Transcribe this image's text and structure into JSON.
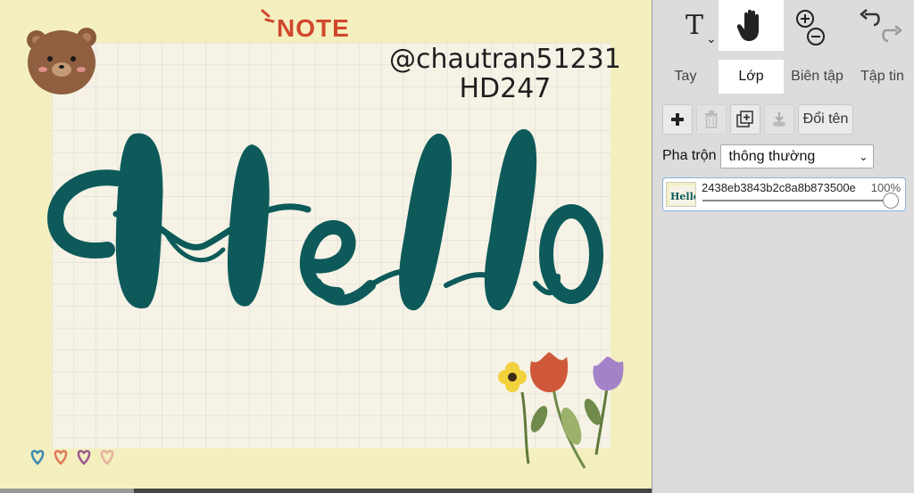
{
  "canvas": {
    "note_label": "NOTE",
    "credit_line1": "@chautran51231",
    "credit_line2": "HD247",
    "lettering": "Hello"
  },
  "toolbar": {
    "text_tool": "T",
    "hand_tool_icon": "hand-icon",
    "zoom_icons": [
      "zoom-in-icon",
      "zoom-out-icon"
    ],
    "history_icons": [
      "undo-icon",
      "redo-icon"
    ]
  },
  "tabs": [
    {
      "label": "Tay",
      "active": false
    },
    {
      "label": "Lớp",
      "active": true
    },
    {
      "label": "Biên tập",
      "active": false
    },
    {
      "label": "Tập tin",
      "active": false
    }
  ],
  "layer_actions": {
    "rename_label": "Đổi tên"
  },
  "blend": {
    "label": "Pha trộn",
    "selected": "thông thường"
  },
  "layer": {
    "name": "2438eb3843b2c8a8b873500e",
    "opacity": "100%",
    "opacity_value": 1.0
  },
  "colors": {
    "lettering": "#0e5a5a",
    "note": "#d0472c",
    "paper": "#f6f3e6",
    "frame": "#f4efbf",
    "accent": "#ffffff"
  }
}
